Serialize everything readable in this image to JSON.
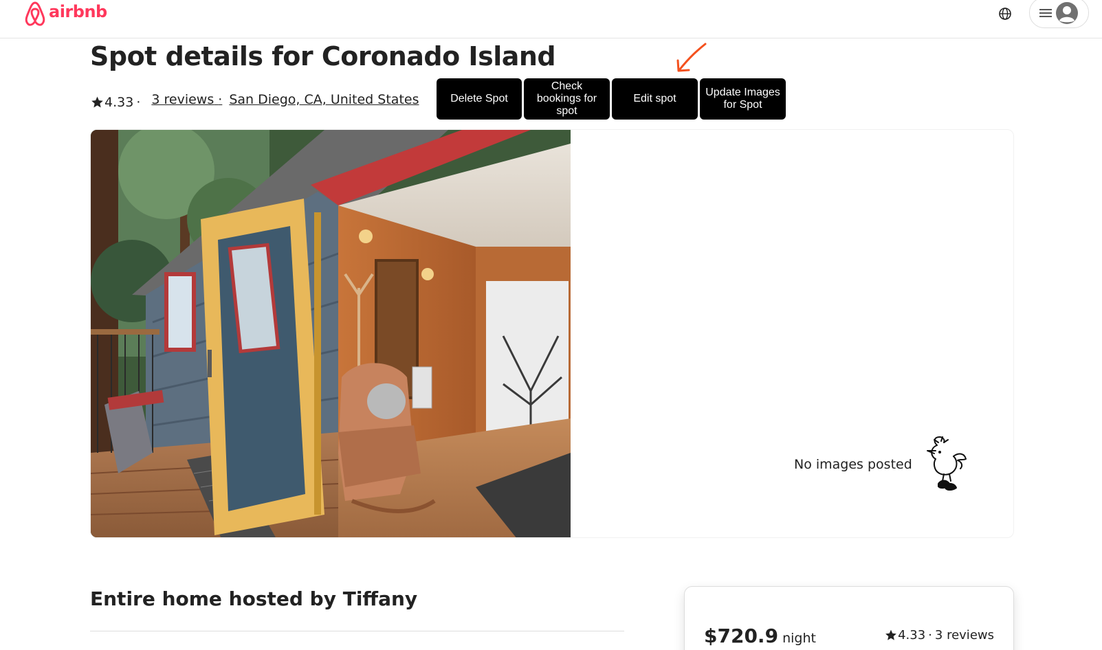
{
  "header": {
    "logo_text": "airbnb",
    "brand_color": "#ff385c",
    "globe_icon": "globe-icon",
    "menu_icon": "hamburger-icon",
    "avatar_icon": "user-avatar-icon"
  },
  "spot": {
    "title": "Spot details for Coronado Island",
    "rating": "4.33",
    "separator": "·",
    "reviews_link": "3 reviews",
    "location": "San Diego, CA, United States"
  },
  "actions": {
    "delete": "Delete Spot",
    "check_bookings": "Check bookings for spot",
    "edit": "Edit spot",
    "update_images": "Update Images for Spot"
  },
  "annotation": {
    "arrow_color": "#f4511e"
  },
  "gallery": {
    "no_images_text": "No images posted"
  },
  "host": {
    "title": "Entire home hosted by Tiffany"
  },
  "booking_card": {
    "price": "$720.9",
    "per_unit": "night",
    "rating": "4.33",
    "separator": "·",
    "reviews": "3 reviews"
  }
}
